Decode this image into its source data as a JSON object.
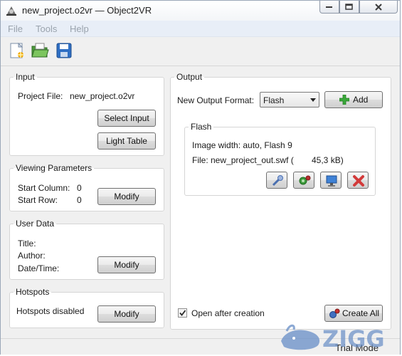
{
  "window": {
    "title": "new_project.o2vr — Object2VR"
  },
  "menu": {
    "items": [
      "File",
      "Tools",
      "Help"
    ]
  },
  "toolbar": {
    "icons": [
      "new-project-icon",
      "open-project-icon",
      "save-icon"
    ]
  },
  "input": {
    "legend": "Input",
    "project_file_label": "Project File:",
    "project_file_value": "new_project.o2vr",
    "select_input_label": "Select Input",
    "light_table_label": "Light Table"
  },
  "viewing": {
    "legend": "Viewing Parameters",
    "start_column_label": "Start Column:",
    "start_column_value": "0",
    "start_row_label": "Start Row:",
    "start_row_value": "0",
    "modify_label": "Modify"
  },
  "user_data": {
    "legend": "User Data",
    "title_label": "Title:",
    "author_label": "Author:",
    "datetime_label": "Date/Time:",
    "modify_label": "Modify"
  },
  "hotspots": {
    "legend": "Hotspots",
    "status": "Hotspots disabled",
    "modify_label": "Modify"
  },
  "output": {
    "legend": "Output",
    "format_label": "New Output Format:",
    "format_value": "Flash",
    "add_label": "Add",
    "flash": {
      "legend": "Flash",
      "info": "Image width: auto, Flash 9",
      "file_label": "File: new_project_out.swf (",
      "file_size": "45,3 kB)"
    },
    "open_after_label": "Open after creation",
    "open_after_checked": true,
    "create_all_label": "Create All"
  },
  "status": {
    "mode": "Trial Mode"
  },
  "watermark": {
    "text": "ZIGG"
  }
}
